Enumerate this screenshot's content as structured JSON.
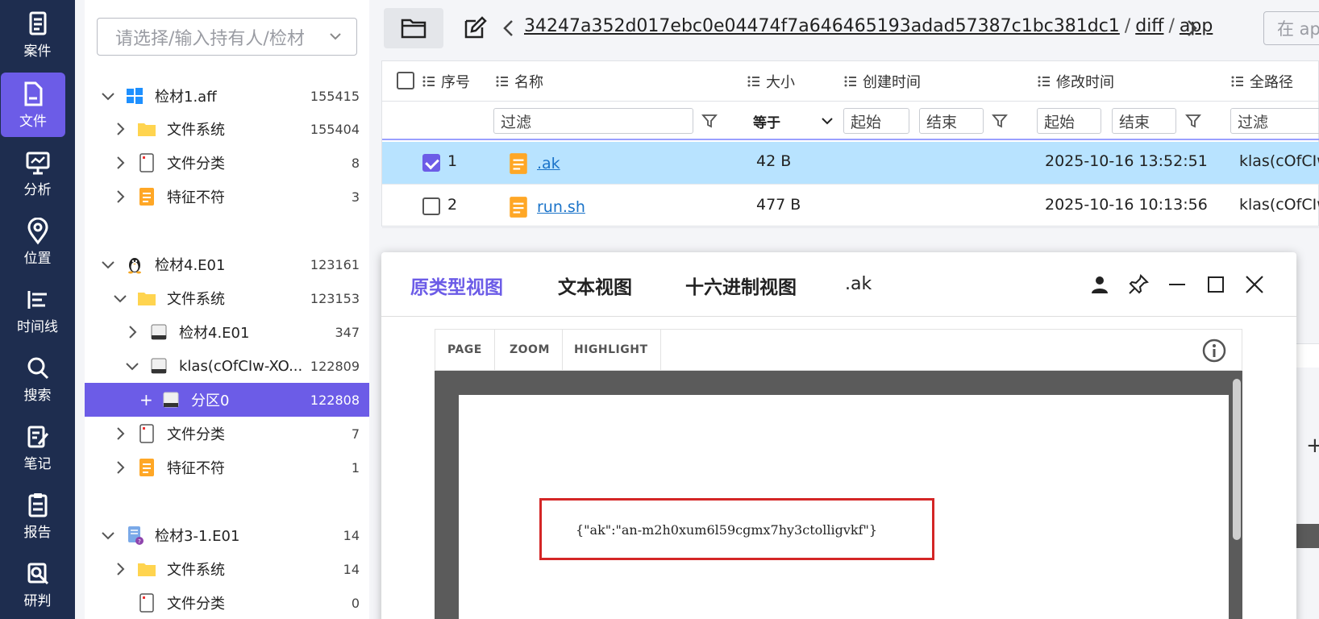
{
  "nav": [
    {
      "label": "案件",
      "icon": "case-icon"
    },
    {
      "label": "文件",
      "icon": "file-icon"
    },
    {
      "label": "分析",
      "icon": "analysis-icon"
    },
    {
      "label": "位置",
      "icon": "location-icon"
    },
    {
      "label": "时间线",
      "icon": "timeline-icon"
    },
    {
      "label": "搜索",
      "icon": "search-icon"
    },
    {
      "label": "笔记",
      "icon": "note-icon"
    },
    {
      "label": "报告",
      "icon": "report-icon"
    },
    {
      "label": "研判",
      "icon": "judge-icon"
    }
  ],
  "tree": {
    "select_placeholder": "请选择/输入持有人/检材",
    "rows": [
      {
        "name": "检材1.aff",
        "count": "155415"
      },
      {
        "name": "文件系统",
        "count": "155404"
      },
      {
        "name": "文件分类",
        "count": "8"
      },
      {
        "name": "特征不符",
        "count": "3"
      },
      {
        "name": "检材4.E01",
        "count": "123161"
      },
      {
        "name": "文件系统",
        "count": "123153"
      },
      {
        "name": "检材4.E01",
        "count": "347"
      },
      {
        "name": "klas(cOfCIw-XO...",
        "count": "122809"
      },
      {
        "name": "分区0",
        "count": "122808",
        "prefix": "+"
      },
      {
        "name": "文件分类",
        "count": "7"
      },
      {
        "name": "特征不符",
        "count": "1"
      },
      {
        "name": "检材3-1.E01",
        "count": "14"
      },
      {
        "name": "文件系统",
        "count": "14"
      },
      {
        "name": "文件分类",
        "count": "0"
      }
    ]
  },
  "breadcrumb": {
    "hash": "34247a352d017ebc0e04474f7a646465193adad57387c1bc381dc1",
    "sep": "/",
    "p1": "diff",
    "p2": "app"
  },
  "search_placeholder": "在 app",
  "table": {
    "headers": {
      "seq": "序号",
      "name": "名称",
      "size": "大小",
      "created": "创建时间",
      "modified": "修改时间",
      "path": "全路径"
    },
    "filters": {
      "name": "过滤",
      "size_op": "等于",
      "start": "起始",
      "end": "结束",
      "path": "过滤"
    },
    "rows": [
      {
        "seq": "1",
        "name": ".ak",
        "size": "42 B",
        "created": "",
        "modified": "2025-10-16 13:52:51",
        "path": "klas(cOfCIw"
      },
      {
        "seq": "2",
        "name": "run.sh",
        "size": "477 B",
        "created": "",
        "modified": "2025-10-16 10:13:56",
        "path": "klas(cOfCIw"
      }
    ]
  },
  "viewer": {
    "tabs": [
      "原类型视图",
      "文本视图",
      "十六进制视图"
    ],
    "title": ".ak",
    "toolbar": [
      "PAGE",
      "ZOOM",
      "HIGHLIGHT"
    ],
    "content": "{\"ak\":\"an-m2h0xum6l59cgmx7hy3ctolligvkf\"}"
  },
  "colors": {
    "accent": "#6c5ce7",
    "nav_bg": "#1e2d4f",
    "selected_row": "#b8e3ff",
    "highlight": "#d42626"
  }
}
